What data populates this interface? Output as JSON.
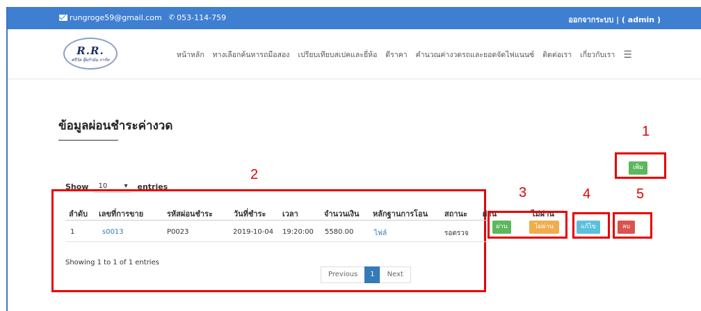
{
  "topbar": {
    "email": "rungroge59@gmail.com",
    "phone": "053-114-759",
    "logout": "ออกจากระบบ | ( admin )"
  },
  "logo": {
    "text": "R.R.",
    "tagline": "ศรีวัล จุ๊ยกำนัน การ์ท"
  },
  "nav": {
    "items": [
      "หน้าหลัก",
      "ทางเลือกค้นหารถมือสอง",
      "เปรียบเทียบสเปคและยี่ห้อ",
      "ดีราคา",
      "คำนวณค่างวดรถและยอดจัดไฟแนนซ์",
      "ติดต่อเรา",
      "เกี่ยวกับเรา"
    ],
    "menu_icon": "hamburger-menu-icon"
  },
  "page": {
    "title": "ข้อมูลผ่อนชำระค่างวด"
  },
  "add_button": "เพิ่ม",
  "length_control": {
    "show": "Show",
    "value": "10",
    "entries": "entries"
  },
  "table": {
    "headers": [
      "ลำดับ",
      "เลขที่การขาย",
      "รหัสผ่อนชำระ",
      "วันที่ชำระ",
      "เวลา",
      "จำนวนเงิน",
      "หลักฐานการโอน",
      "สถานะ",
      "ผ่าน",
      "ไม่ผ่าน"
    ],
    "rows": [
      {
        "no": "1",
        "sale_id": "s0013",
        "payment_code": "P0023",
        "date": "2019-10-04",
        "time": "19:20:00",
        "amount": "5580.00",
        "proof": "ไฟล์",
        "status": "รอตรวจ"
      }
    ],
    "actions": {
      "pass": "ผ่าน",
      "fail": "ไม่ผ่าน",
      "edit": "แก้ไข",
      "delete": "ลบ"
    },
    "info": "Showing 1 to 1 of 1 entries",
    "pager": {
      "previous": "Previous",
      "current": "1",
      "next": "Next"
    }
  },
  "annotations": [
    "1",
    "2",
    "3",
    "4",
    "5"
  ]
}
